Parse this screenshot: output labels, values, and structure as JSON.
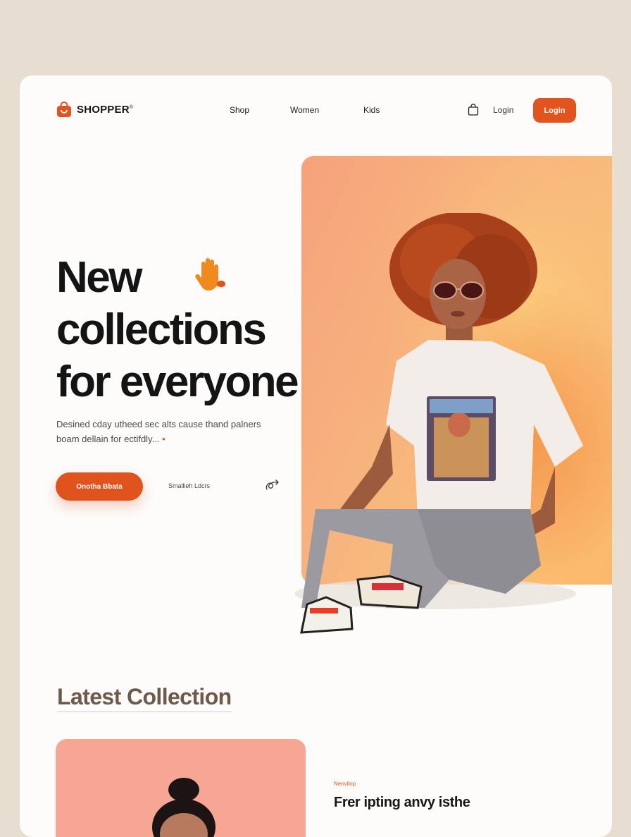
{
  "brand": {
    "name": "SHOPPER",
    "mark": "®"
  },
  "nav": {
    "items": [
      {
        "label": "Shop"
      },
      {
        "label": "Women"
      },
      {
        "label": "Kids"
      }
    ],
    "login_link": "Login",
    "login_button": "Login"
  },
  "hero": {
    "title_lines": [
      "New",
      "collections",
      "for everyone"
    ],
    "description_line1": "Desined cday utheed sec alts cause thand palners",
    "description_line2": "boam dellain for ectifdly...",
    "description_dot": "•",
    "cta_label": "Onotha Bbata",
    "secondary_label": "Smallieh Ldcrs"
  },
  "latest": {
    "title": "Latest Collection",
    "product_tag": "Nenvilop",
    "product_title": "Frer ipting anvy isthe"
  },
  "icons": {
    "logo": "shopping-bag-logo-icon",
    "cart": "shopping-bag-icon",
    "hand": "waving-hand-icon",
    "loop": "loop-arrow-icon"
  },
  "colors": {
    "accent": "#e2541d",
    "page_bg": "#e7ddd0",
    "card_bg": "#fdfcfb",
    "section_title": "#6e5a4a"
  }
}
